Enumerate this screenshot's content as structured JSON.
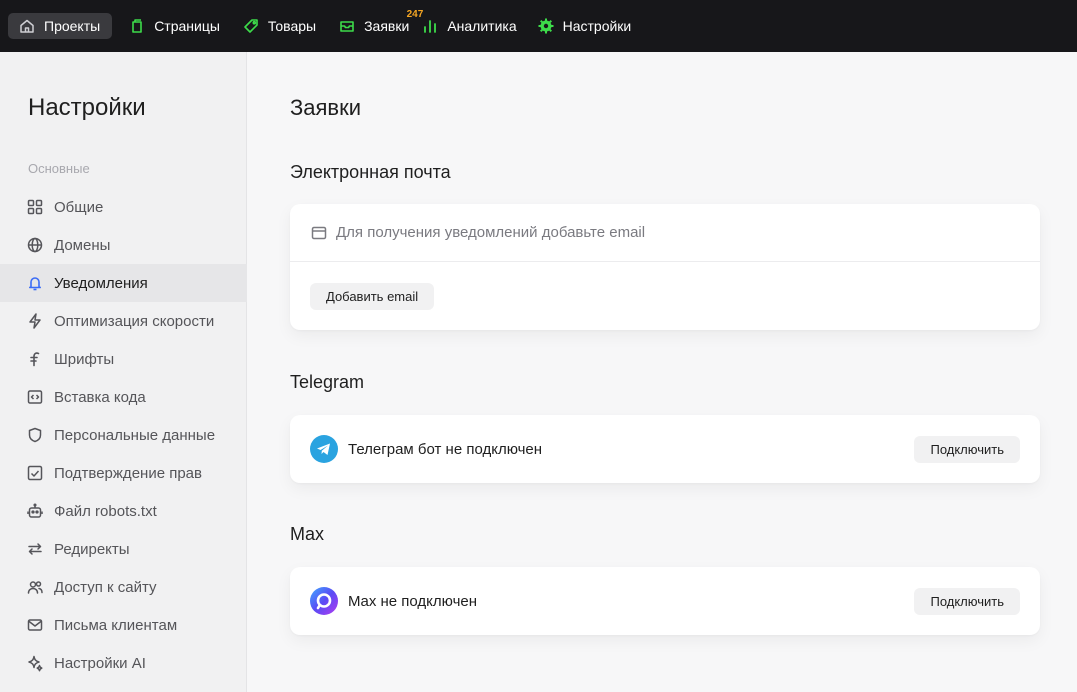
{
  "topnav": {
    "items": [
      {
        "label": "Проекты",
        "icon": "home-icon",
        "active": true
      },
      {
        "label": "Страницы",
        "icon": "page-icon"
      },
      {
        "label": "Товары",
        "icon": "tag-icon"
      },
      {
        "label": "Заявки",
        "icon": "inbox-icon",
        "badge": "247"
      },
      {
        "label": "Аналитика",
        "icon": "chart-icon"
      },
      {
        "label": "Настройки",
        "icon": "gear-icon"
      }
    ],
    "accent": "#3ddc4a",
    "badge_color": "#f5a623"
  },
  "sidebar": {
    "title": "Настройки",
    "group_label": "Основные",
    "items": [
      {
        "label": "Общие",
        "icon": "grid-icon"
      },
      {
        "label": "Домены",
        "icon": "globe-icon"
      },
      {
        "label": "Уведомления",
        "icon": "bell-icon",
        "active": true
      },
      {
        "label": "Оптимизация скорости",
        "icon": "lightning-icon"
      },
      {
        "label": "Шрифты",
        "icon": "font-icon"
      },
      {
        "label": "Вставка кода",
        "icon": "code-icon"
      },
      {
        "label": "Персональные данные",
        "icon": "shield-icon"
      },
      {
        "label": "Подтверждение прав",
        "icon": "checkbox-icon"
      },
      {
        "label": "Файл robots.txt",
        "icon": "robot-icon"
      },
      {
        "label": "Редиректы",
        "icon": "arrows-icon"
      },
      {
        "label": "Доступ к сайту",
        "icon": "users-icon"
      },
      {
        "label": "Письма клиентам",
        "icon": "mail-icon"
      },
      {
        "label": "Настройки AI",
        "icon": "sparkle-icon"
      }
    ]
  },
  "main": {
    "title": "Заявки",
    "email": {
      "title": "Электронная почта",
      "info": "Для получения уведомлений добавьте email",
      "button": "Добавить email"
    },
    "telegram": {
      "title": "Telegram",
      "status": "Телеграм бот не подключен",
      "button": "Подключить"
    },
    "max": {
      "title": "Max",
      "status": "Max не подключен",
      "button": "Подключить"
    }
  }
}
